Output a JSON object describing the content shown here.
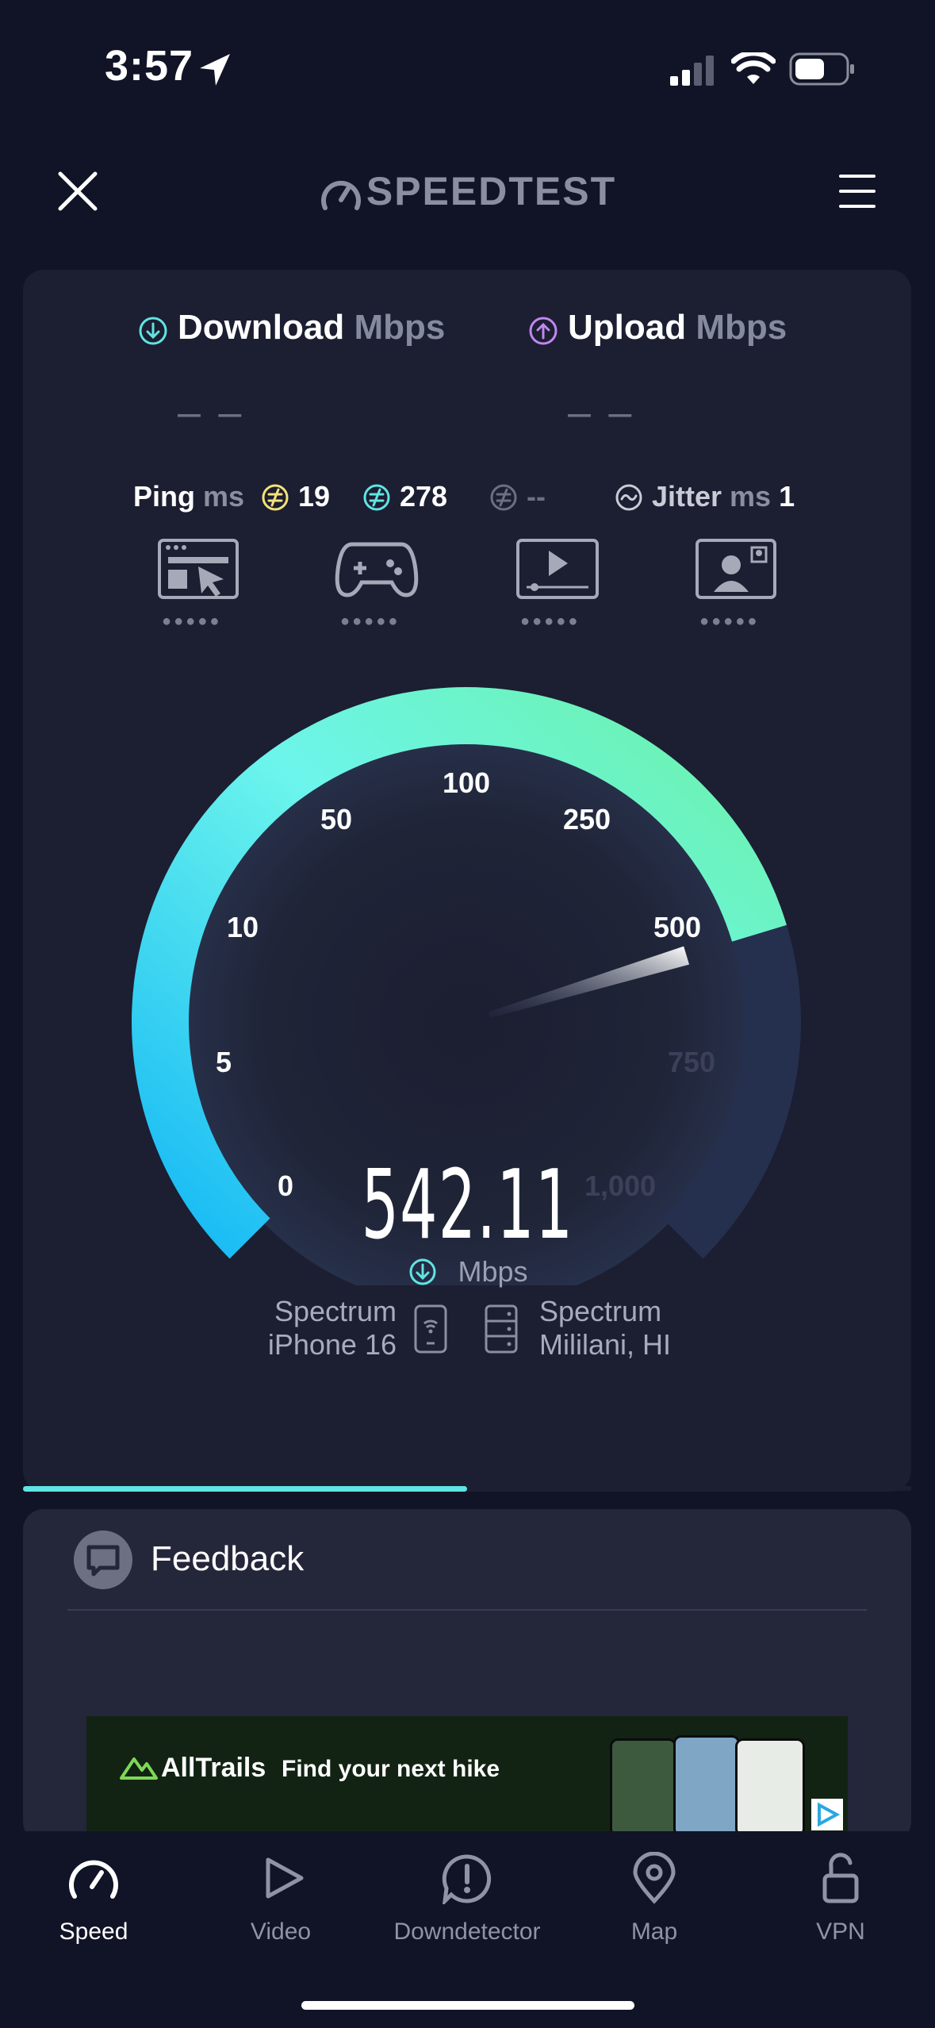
{
  "status_bar": {
    "time": "3:57"
  },
  "header": {
    "logo_text": "SPEEDTEST",
    "close_icon": "close-icon",
    "menu_icon": "hamburger-menu-icon"
  },
  "results": {
    "download_label": "Download",
    "download_unit": "Mbps",
    "download_value": "– –",
    "upload_label": "Upload",
    "upload_unit": "Mbps",
    "upload_value": "– –",
    "ping_label": "Ping",
    "ping_unit": "ms",
    "ping_idle": "19",
    "ping_download": "278",
    "ping_upload": "--",
    "jitter_label": "Jitter",
    "jitter_unit": "ms",
    "jitter_value": "1"
  },
  "gauge": {
    "ticks": [
      "0",
      "5",
      "10",
      "50",
      "100",
      "250",
      "500",
      "750",
      "1,000"
    ],
    "value": "542.11",
    "unit": "Mbps",
    "needle_value": 542.11,
    "colors": {
      "start": "#14b8f5",
      "mid": "#6cf5ec",
      "end": "#6cf2a8"
    }
  },
  "connection": {
    "isp_name": "Spectrum",
    "device": "iPhone 16",
    "server_name": "Spectrum",
    "server_location": "Mililani, HI"
  },
  "progress": {
    "fraction": 0.5
  },
  "feedback": {
    "label": "Feedback"
  },
  "ad": {
    "brand": "AllTrails",
    "tagline": "Find your next hike"
  },
  "tabs": [
    {
      "label": "Speed",
      "icon": "speedometer-icon",
      "active": true
    },
    {
      "label": "Video",
      "icon": "play-icon",
      "active": false
    },
    {
      "label": "Downdetector",
      "icon": "alert-icon",
      "active": false
    },
    {
      "label": "Map",
      "icon": "map-pin-icon",
      "active": false
    },
    {
      "label": "VPN",
      "icon": "lock-icon",
      "active": false
    }
  ]
}
